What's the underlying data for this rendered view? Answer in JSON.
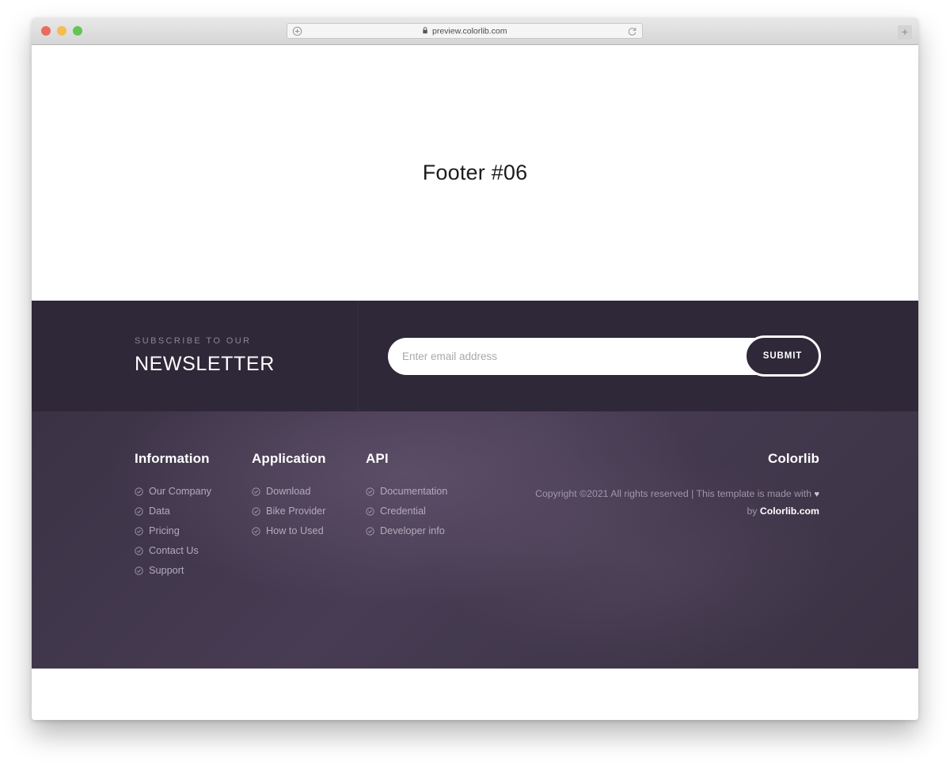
{
  "browser": {
    "url": "preview.colorlib.com",
    "lock_icon": "lock-icon",
    "reload_icon": "reload-icon",
    "add_icon": "plus-circle-icon",
    "new_tab_label": "+",
    "traffic_lights": [
      "close",
      "minimize",
      "maximize"
    ]
  },
  "hero": {
    "title": "Footer #06"
  },
  "newsletter": {
    "eyebrow": "SUBSCRIBE TO OUR",
    "title": "NEWSLETTER",
    "input_placeholder": "Enter email address",
    "input_value": "",
    "submit_label": "SUBMIT"
  },
  "footer": {
    "columns": [
      {
        "title": "Information",
        "items": [
          {
            "label": "Our Company"
          },
          {
            "label": "Data"
          },
          {
            "label": "Pricing"
          },
          {
            "label": "Contact Us"
          },
          {
            "label": "Support"
          }
        ]
      },
      {
        "title": "Application",
        "items": [
          {
            "label": "Download"
          },
          {
            "label": "Bike Provider"
          },
          {
            "label": "How to Used"
          }
        ]
      },
      {
        "title": "API",
        "items": [
          {
            "label": "Documentation"
          },
          {
            "label": "Credential"
          },
          {
            "label": "Developer info"
          }
        ]
      }
    ],
    "brand": {
      "title": "Colorlib",
      "copyright_prefix": "Copyright ©2021 All rights reserved | This template is made with ",
      "heart": "♥",
      "copyright_middle": " by ",
      "brand_link": "Colorlib.com"
    }
  },
  "colors": {
    "newsletter_bg": "#2e2839",
    "footer_bg": "#473c53",
    "accent_text": "#b3aabb",
    "white": "#ffffff"
  }
}
